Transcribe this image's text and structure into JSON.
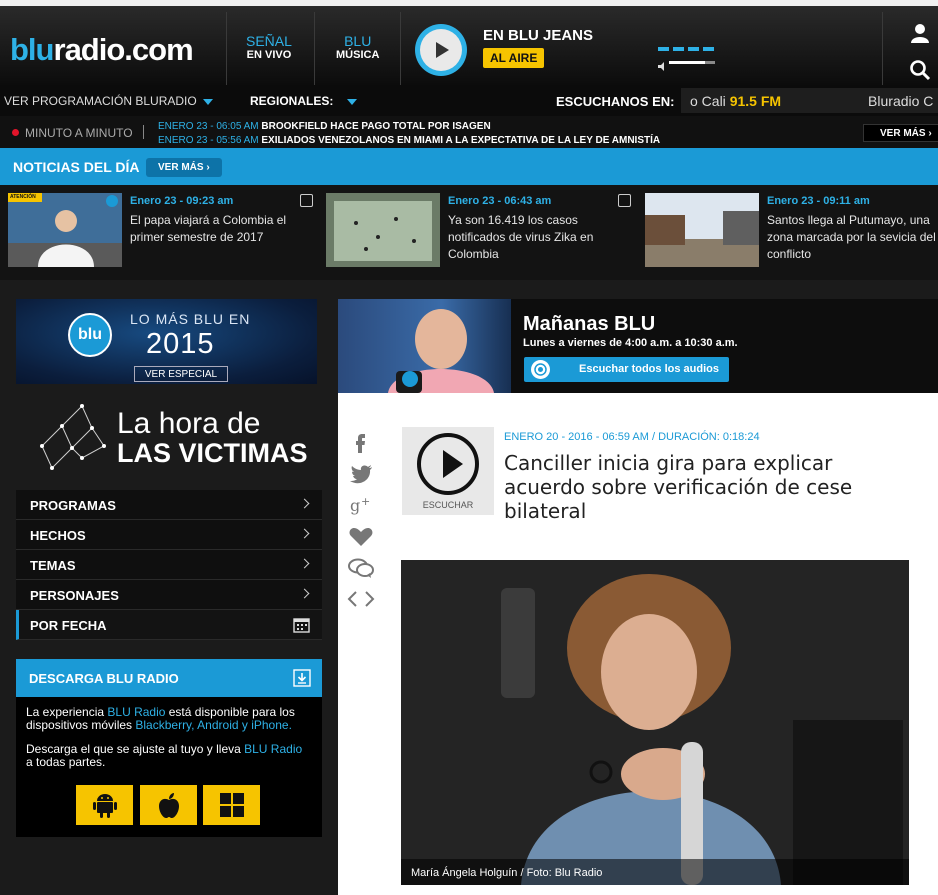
{
  "header": {
    "logo_part1": "blu",
    "logo_part2": "radio.com",
    "nav": [
      {
        "line1": "SEÑAL",
        "line2": "EN VIVO"
      },
      {
        "line1": "BLU",
        "line2": "MÚSICA"
      }
    ],
    "now_playing": "EN BLU JEANS",
    "live_badge": "AL AIRE",
    "icons": {
      "user": "user-icon",
      "search": "search-icon",
      "play": "play-icon",
      "volume": "volume-icon"
    }
  },
  "subbar": {
    "programacion": "VER PROGRAMACIÓN BLURADIO",
    "regionales": "REGIONALES:",
    "escuchanos": "ESCUCHANOS EN:",
    "city": "o Cali",
    "frequency": "91.5 FM",
    "extra": "Bluradio C"
  },
  "ticker": {
    "label": "MINUTO A MINUTO",
    "items": [
      {
        "date": "ENERO 23 - 06:05 AM",
        "text": "BROOKFIELD HACE PAGO TOTAL POR ISAGEN"
      },
      {
        "date": "ENERO 23 - 05:56 AM",
        "text": "EXILIADOS VENEZOLANOS EN MIAMI A LA EXPECTATIVA DE LA LEY DE AMNISTÍA"
      }
    ],
    "more": "VER MÁS"
  },
  "noticias": {
    "title": "NOTICIAS DEL DÍA",
    "more": "VER MÁS",
    "cards": [
      {
        "badge": "ATENCIÓN",
        "date": "Enero 23 - 09:23 am",
        "text": "El papa viajará a Colombia el primer semestre de 2017"
      },
      {
        "date": "Enero 23 - 06:43 am",
        "text": "Ya son 16.419 los casos notificados de virus Zika en Colombia"
      },
      {
        "date": "Enero 23 - 09:11 am",
        "text": "Santos llega al Putumayo, una zona marcada por la sevicia del conflicto"
      }
    ]
  },
  "sidebar": {
    "banner": {
      "logo": "blu",
      "line1": "LO MÁS BLU EN",
      "year": "2015",
      "button": "VER ESPECIAL"
    },
    "victimas": {
      "line1": "La hora de",
      "line2": "LAS VICTIMAS"
    },
    "menu": [
      "PROGRAMAS",
      "HECHOS",
      "TEMAS",
      "PERSONAJES",
      "POR FECHA"
    ],
    "download": {
      "title": "DESCARGA BLU RADIO",
      "p1_a": "La experiencia ",
      "p1_link": "BLU Radio",
      "p1_b": " está disponible para los dispositivos móviles ",
      "p1_link2": "Blackberry, Android y iPhone.",
      "p2_a": "Descarga el que se ajuste al tuyo y lleva ",
      "p2_link": "BLU Radio",
      "p2_b": " a todas partes."
    }
  },
  "main": {
    "show": {
      "title": "Mañanas BLU",
      "schedule": "Lunes a viernes de 4:00 a.m. a 10:30 a.m.",
      "button": "Escuchar todos los audios"
    },
    "article": {
      "date": "ENERO 20 - 2016 - 06:59 AM / DURACIÓN: 0:18:24",
      "title": "Canciller inicia gira para explicar acuerdo sobre verificación de cese bilateral",
      "listen": "ESCUCHAR",
      "caption": "María Ángela Holguín / Foto: Blu Radio"
    }
  },
  "colors": {
    "accent": "#1b9ad6",
    "yellow": "#f6c400",
    "dark": "#1b1b1b"
  }
}
